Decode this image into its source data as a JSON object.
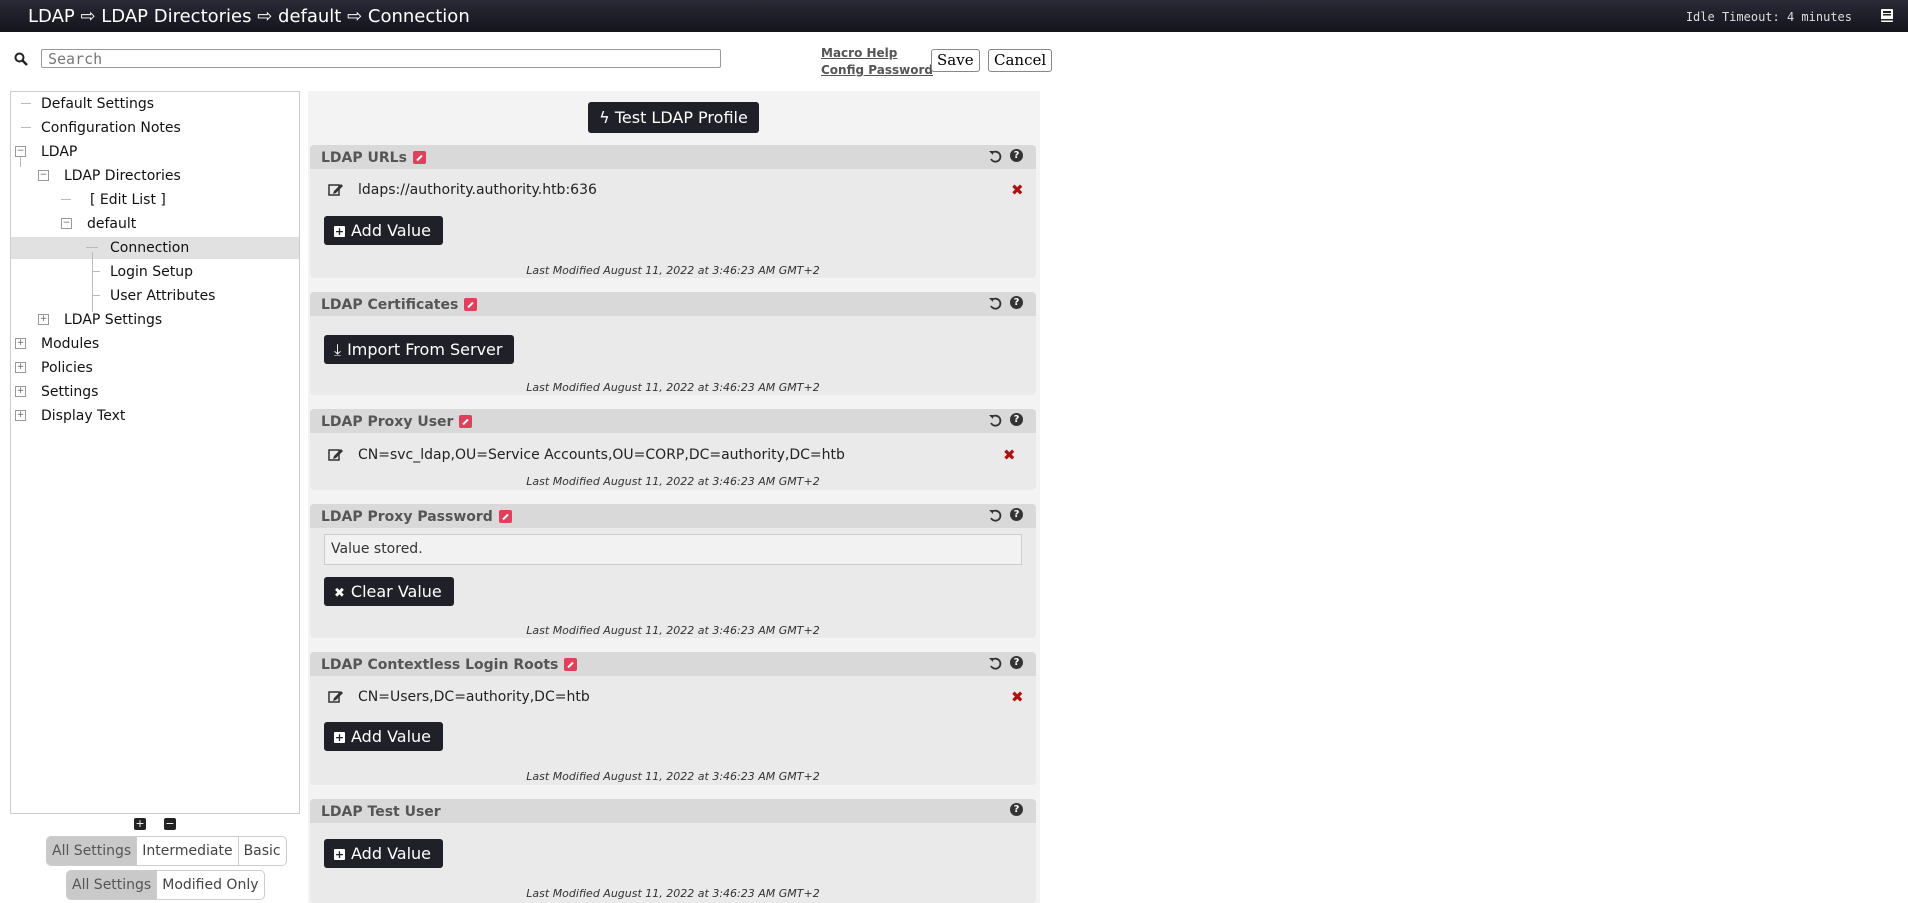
{
  "header": {
    "breadcrumb": "LDAP ⇨ LDAP Directories ⇨ default ⇨ Connection",
    "idle": "Idle Timeout: 4 minutes"
  },
  "search": {
    "placeholder": "Search"
  },
  "links": {
    "macro_help": "Macro Help",
    "config_password": "Config Password"
  },
  "buttons": {
    "save": "Save",
    "cancel": "Cancel",
    "test_ldap": "Test LDAP Profile"
  },
  "tree": {
    "default_settings": "Default Settings",
    "configuration_notes": "Configuration Notes",
    "ldap": "LDAP",
    "ldap_directories": "LDAP Directories",
    "edit_list": "[  Edit List  ]",
    "default": "default",
    "connection": "Connection",
    "login_setup": "Login Setup",
    "user_attributes": "User Attributes",
    "ldap_settings": "LDAP Settings",
    "modules": "Modules",
    "policies": "Policies",
    "settings": "Settings",
    "display_text": "Display Text"
  },
  "level_filter": {
    "options": [
      "All Settings",
      "Intermediate",
      "Basic"
    ],
    "selected": "All Settings"
  },
  "mod_filter": {
    "options": [
      "All Settings",
      "Modified Only"
    ],
    "selected": "All Settings"
  },
  "last_modified": "Last Modified August 11, 2022 at 3:46:23 AM GMT+2",
  "panels": {
    "urls": {
      "title": "LDAP URLs",
      "value": "ldaps://authority.authority.htb:636",
      "button": "Add Value"
    },
    "certs": {
      "title": "LDAP Certificates",
      "button": "Import From Server"
    },
    "proxy_user": {
      "title": "LDAP Proxy User",
      "value": "CN=svc_ldap,OU=Service Accounts,OU=CORP,DC=authority,DC=htb"
    },
    "proxy_password": {
      "title": "LDAP Proxy Password",
      "stored": "Value stored.",
      "button": "Clear Value"
    },
    "roots": {
      "title": "LDAP Contextless Login Roots",
      "value": "CN=Users,DC=authority,DC=htb",
      "button": "Add Value"
    },
    "test_user": {
      "title": "LDAP Test User",
      "button": "Add Value"
    }
  },
  "icons": [
    "search-icon",
    "book-icon",
    "undo-icon",
    "help-icon",
    "pencil-icon",
    "delete-icon",
    "plus-icon",
    "download-icon",
    "bolt-icon",
    "times-icon",
    "expand-all-icon",
    "collapse-all-icon"
  ]
}
